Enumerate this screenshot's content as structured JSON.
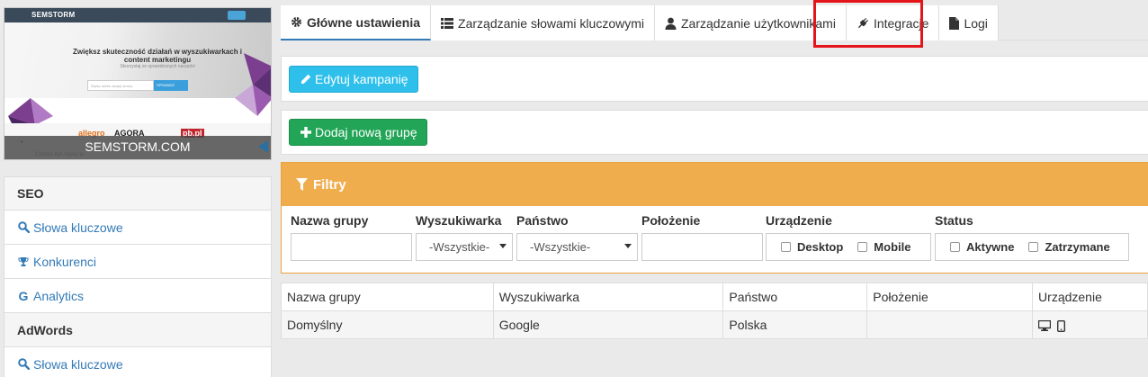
{
  "thumbnail": {
    "logo": "SEMSTORM",
    "headline": "Zwiększ skuteczność działań w wyszukiwarkach i content marketingu",
    "subline": "Skorzystaj ze sprawdzonych narzędzi",
    "search_placeholder": "Wpisz adres swojej strony",
    "search_button": "SPRAWDŹ",
    "brands": [
      "allegro",
      "AGORA",
      "pb.pl"
    ],
    "bottom_text": "Chcesz być wyżej w",
    "caption": "SEMSTORM.COM"
  },
  "sidebar": {
    "sections": [
      {
        "title": "SEO",
        "items": [
          {
            "label": "Słowa kluczowe",
            "icon": "search-icon"
          },
          {
            "label": "Konkurenci",
            "icon": "trophy-icon"
          },
          {
            "label": "Analytics",
            "icon": "google-icon"
          }
        ]
      },
      {
        "title": "AdWords",
        "items": [
          {
            "label": "Słowa kluczowe",
            "icon": "search-icon"
          }
        ]
      }
    ]
  },
  "tabs": [
    {
      "label": "Główne ustawienia",
      "icon": "gear-icon",
      "active": true
    },
    {
      "label": "Zarządzanie słowami kluczowymi",
      "icon": "list-icon"
    },
    {
      "label": "Zarządzanie użytkownikami",
      "icon": "user-icon"
    },
    {
      "label": "Integracje",
      "icon": "plug-icon"
    },
    {
      "label": "Logi",
      "icon": "file-icon"
    }
  ],
  "buttons": {
    "edit_campaign": "Edytuj kampanię",
    "add_group": "Dodaj nową grupę"
  },
  "filters": {
    "title": "Filtry",
    "labels": {
      "group_name": "Nazwa grupy",
      "engine": "Wyszukiwarka",
      "country": "Państwo",
      "location": "Położenie",
      "device": "Urządzenie",
      "status": "Status"
    },
    "engine_selected": "-Wszystkie-",
    "country_selected": "-Wszystkie-",
    "device_options": [
      "Desktop",
      "Mobile"
    ],
    "status_options": [
      "Aktywne",
      "Zatrzymane"
    ]
  },
  "table": {
    "headers": [
      "Nazwa grupy",
      "Wyszukiwarka",
      "Państwo",
      "Położenie",
      "Urządzenie"
    ],
    "rows": [
      {
        "name": "Domyślny",
        "engine": "Google",
        "country": "Polska",
        "location": "",
        "device_icons": [
          "desktop-icon",
          "mobile-icon"
        ]
      }
    ]
  },
  "colors": {
    "accent": "#337ab7",
    "info": "#2ec0eb",
    "success": "#22a557",
    "warning": "#f0ad4e",
    "highlight": "#e4141b"
  }
}
